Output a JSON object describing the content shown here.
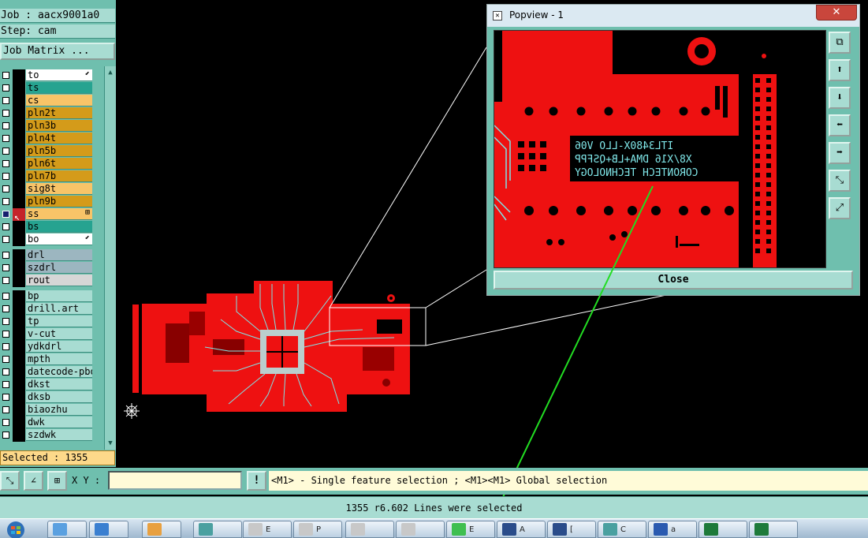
{
  "header": {
    "job": "Job : aacx9001a0",
    "step": "Step: cam",
    "job_matrix_button": "Job Matrix ..."
  },
  "layers": [
    {
      "name": "to",
      "color": "#ffffff",
      "mark": "⬋"
    },
    {
      "name": "ts",
      "color": "#26a390"
    },
    {
      "name": "cs",
      "color": "#f8c468"
    },
    {
      "name": "pln2t",
      "color": "#d49b1a"
    },
    {
      "name": "pln3b",
      "color": "#d49b1a"
    },
    {
      "name": "pln4t",
      "color": "#d49b1a"
    },
    {
      "name": "pln5b",
      "color": "#d49b1a"
    },
    {
      "name": "pln6t",
      "color": "#d49b1a"
    },
    {
      "name": "pln7b",
      "color": "#d49b1a"
    },
    {
      "name": "sig8t",
      "color": "#f8c468"
    },
    {
      "name": "pln9b",
      "color": "#d49b1a"
    },
    {
      "name": "ss",
      "color": "#f8c468",
      "active": true,
      "mark": "⊞"
    },
    {
      "name": "bs",
      "color": "#26a390"
    },
    {
      "name": "bo",
      "color": "#ffffff",
      "mark": "⬋"
    },
    {
      "name": "drl",
      "color": "#9cb6c0"
    },
    {
      "name": "szdrl",
      "color": "#9cb6c0"
    },
    {
      "name": "rout",
      "color": "#d6d6d6"
    },
    {
      "name": "bp",
      "color": "#a8dcd2"
    },
    {
      "name": "drill.art",
      "color": "#a8dcd2"
    },
    {
      "name": "tp",
      "color": "#a8dcd2"
    },
    {
      "name": "v-cut",
      "color": "#a8dcd2"
    },
    {
      "name": "ydkdrl",
      "color": "#a8dcd2"
    },
    {
      "name": "mpth",
      "color": "#a8dcd2"
    },
    {
      "name": "datecode-pbo",
      "color": "#a8dcd2"
    },
    {
      "name": "dkst",
      "color": "#a8dcd2"
    },
    {
      "name": "dksb",
      "color": "#a8dcd2"
    },
    {
      "name": "biaozhu",
      "color": "#a8dcd2"
    },
    {
      "name": "dwk",
      "color": "#a8dcd2"
    },
    {
      "name": "szdwk",
      "color": "#a8dcd2"
    }
  ],
  "selected": "Selected : 1355",
  "popview": {
    "title": "Popview - 1",
    "close_label": "Close",
    "silkscreen": [
      "ITL3480X-LLO V06",
      "X8/X16 DMA+LB+QSFPP",
      "CORONTECH TECHNOLOGY"
    ],
    "tools": [
      "zoom-home-icon",
      "pan-up-icon",
      "pan-down-icon",
      "pan-left-icon",
      "pan-right-icon",
      "zoom-out-icon",
      "zoom-in-icon"
    ]
  },
  "cmdbar": {
    "xy_label": "X Y :",
    "xy_value": "",
    "message": "<M1> - Single feature selection ; <M1><M1> Global selection"
  },
  "status": "1355 r6.602 Lines were selected",
  "taskbar": [
    {
      "label": "",
      "color": "#5aa0e0"
    },
    {
      "label": "",
      "color": "#3a7fd0"
    },
    {
      "label": "",
      "color": "#e8a040"
    },
    {
      "label": "",
      "color": "#4aa0a0"
    },
    {
      "label": "E",
      "color": "#c8c8c8"
    },
    {
      "label": "P",
      "color": "#c8c8c8"
    },
    {
      "label": "",
      "color": "#c8c8c8"
    },
    {
      "label": "",
      "color": "#c8c8c8"
    },
    {
      "label": "E",
      "color": "#3fbf50"
    },
    {
      "label": "A",
      "color": "#2a4c8a"
    },
    {
      "label": "[",
      "color": "#2a4c8a"
    },
    {
      "label": "C",
      "color": "#4aa0a0"
    },
    {
      "label": "a",
      "color": "#2a5ab0"
    },
    {
      "label": "",
      "color": "#1e7a3a"
    },
    {
      "label": "",
      "color": "#1e7a3a"
    }
  ]
}
